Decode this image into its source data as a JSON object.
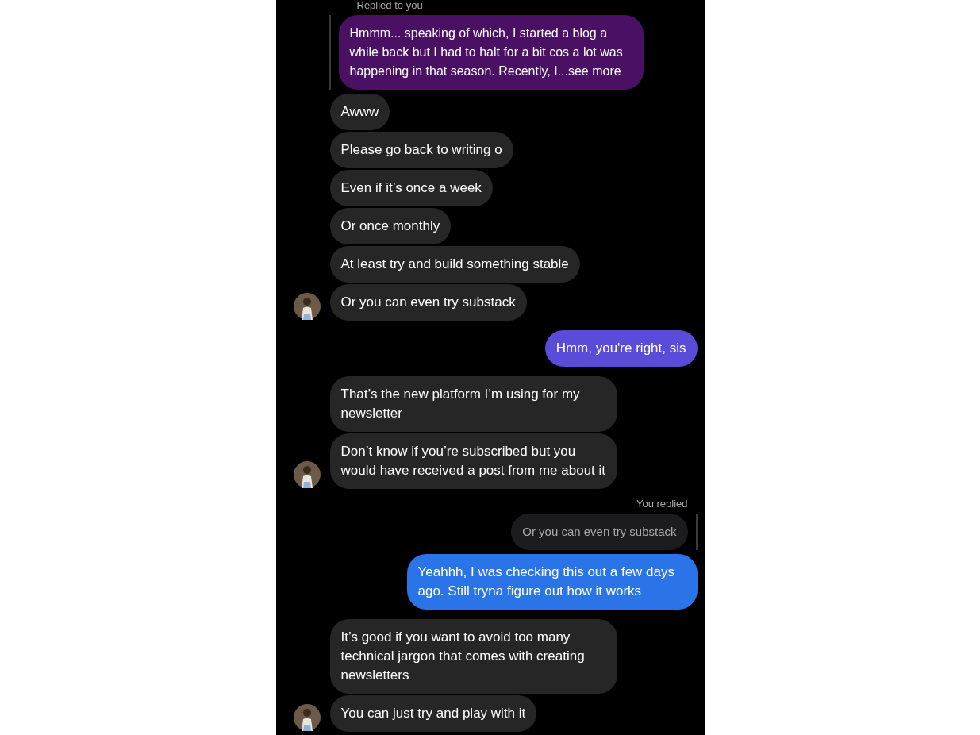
{
  "messages": [
    {
      "kind": "incominglabel",
      "text": "Replied to you"
    },
    {
      "kind": "incomingquote",
      "text": "Hmmm... speaking of which, I started a blog a while back but I had to halt for a bit cos a lot was happening in that season. Recently, I...see more",
      "color": "#4a1064"
    },
    {
      "kind": "incoming",
      "text": "Awww",
      "avatar": false
    },
    {
      "kind": "incoming",
      "text": "Please go back to writing o",
      "avatar": false
    },
    {
      "kind": "incoming",
      "text": "Even if it’s once a week",
      "avatar": false
    },
    {
      "kind": "incoming",
      "text": "Or once monthly",
      "avatar": false
    },
    {
      "kind": "incoming",
      "text": "At least try and build something stable",
      "avatar": false
    },
    {
      "kind": "incoming",
      "text": "Or you can even try substack",
      "avatar": true
    },
    {
      "kind": "outgoing",
      "text": "Hmm, you're right, sis",
      "color": "#5a4bd8"
    },
    {
      "kind": "incoming",
      "text": "That’s the new platform I’m using for my newsletter",
      "avatar": false
    },
    {
      "kind": "incoming",
      "text": "Don’t know if you’re subscribed but you would have received a post from me about it",
      "avatar": true
    },
    {
      "kind": "outgoinglabel",
      "text": "You replied"
    },
    {
      "kind": "outgoingquote",
      "text": "Or you can even try substack",
      "color": "#1c1c1e"
    },
    {
      "kind": "outgoing",
      "text": "Yeahhh, I was checking this out a few days ago. Still tryna figure out how it works",
      "color": "#2b74e7"
    },
    {
      "kind": "incoming",
      "text": "It’s good if you want to avoid too many technical jargon that comes with creating newsletters",
      "avatar": false
    },
    {
      "kind": "incoming",
      "text": "You can just try and play with it",
      "avatar": true
    }
  ]
}
